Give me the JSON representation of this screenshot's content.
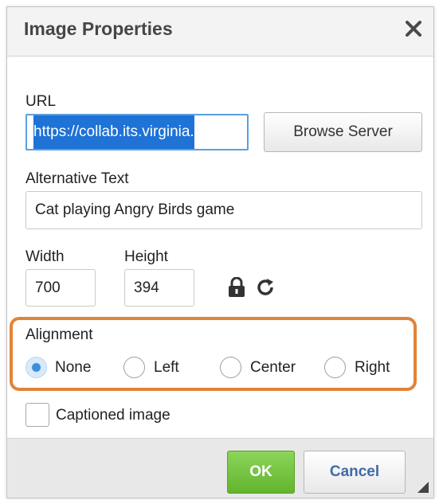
{
  "dialog": {
    "title": "Image Properties"
  },
  "url": {
    "label": "URL",
    "value": "https://collab.its.virginia.",
    "browse_label": "Browse Server"
  },
  "alt_text": {
    "label": "Alternative Text",
    "value": "Cat playing Angry Birds game"
  },
  "dimensions": {
    "width_label": "Width",
    "width_value": "700",
    "height_label": "Height",
    "height_value": "394"
  },
  "alignment": {
    "label": "Alignment",
    "options": [
      "None",
      "Left",
      "Center",
      "Right"
    ],
    "selected": "None"
  },
  "caption": {
    "label": "Captioned image",
    "checked": false
  },
  "footer": {
    "ok_label": "OK",
    "cancel_label": "Cancel"
  },
  "colors": {
    "highlight_outline": "#e0843a",
    "ok_button": "#6dbf38",
    "selection": "#1f72d6"
  },
  "icons": [
    "close-icon",
    "lock-icon",
    "reset-icon",
    "resize-handle-icon"
  ]
}
